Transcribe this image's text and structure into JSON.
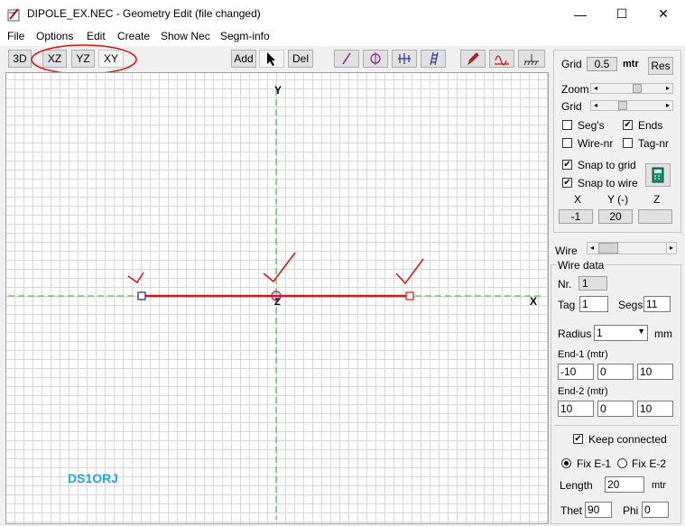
{
  "window": {
    "title": "DIPOLE_EX.NEC - Geometry Edit (file changed)",
    "minimize": "—",
    "maximize": "☐",
    "close": "✕"
  },
  "menu": [
    "File",
    "Options",
    "Edit",
    "Create",
    "Show Nec",
    "Segm-info"
  ],
  "toolbar": {
    "view_3d": "3D",
    "view_xz": "XZ",
    "view_yz": "YZ",
    "view_xy": "XY",
    "add": "Add",
    "del": "Del"
  },
  "canvas": {
    "axis_y": "Y",
    "axis_x": "X",
    "axis_z": "Z",
    "watermark": "DS1ORJ"
  },
  "panel": {
    "grid_label": "Grid",
    "grid_value": "0.5",
    "grid_unit": "mtr",
    "res_button": "Res",
    "zoom_label": "Zoom",
    "grid_slider_label": "Grid",
    "segs": {
      "label": "Seg's",
      "checked": false
    },
    "ends": {
      "label": "Ends",
      "checked": true
    },
    "wire_nr": {
      "label": "Wire-nr",
      "checked": false
    },
    "tag_nr": {
      "label": "Tag-nr",
      "checked": false
    },
    "snap_grid": {
      "label": "Snap to grid",
      "checked": true
    },
    "snap_wire": {
      "label": "Snap to wire",
      "checked": true
    },
    "coord_x_label": "X",
    "coord_y_label": "Y (-)",
    "coord_z_label": "Z",
    "coord_x": "-1",
    "coord_y": "20",
    "coord_z": "",
    "wire_label": "Wire",
    "wire_data_title": "Wire data",
    "nr_label": "Nr.",
    "nr_value": "1",
    "tag_label": "Tag",
    "tag_value": "1",
    "segs_label": "Segs",
    "segs_value": "11",
    "radius_label": "Radius",
    "radius_value": "1",
    "radius_unit": "mm",
    "end1_label": "End-1 (mtr)",
    "end1": [
      "-10",
      "0",
      "10"
    ],
    "end2_label": "End-2 (mtr)",
    "end2": [
      "10",
      "0",
      "10"
    ],
    "keep_connected": {
      "label": "Keep connected",
      "checked": true
    },
    "fix_e1": {
      "label": "Fix E-1",
      "selected": true
    },
    "fix_e2": {
      "label": "Fix E-2",
      "selected": false
    },
    "length_label": "Length",
    "length_value": "20",
    "length_unit": "mtr",
    "thet_label": "Thet",
    "thet_value": "90",
    "phi_label": "Phi",
    "phi_value": "0"
  },
  "colors": {
    "wire": "#e01010",
    "axis": "#22bb22",
    "annotation": "#e01010",
    "watermark": "#29a3dc"
  }
}
